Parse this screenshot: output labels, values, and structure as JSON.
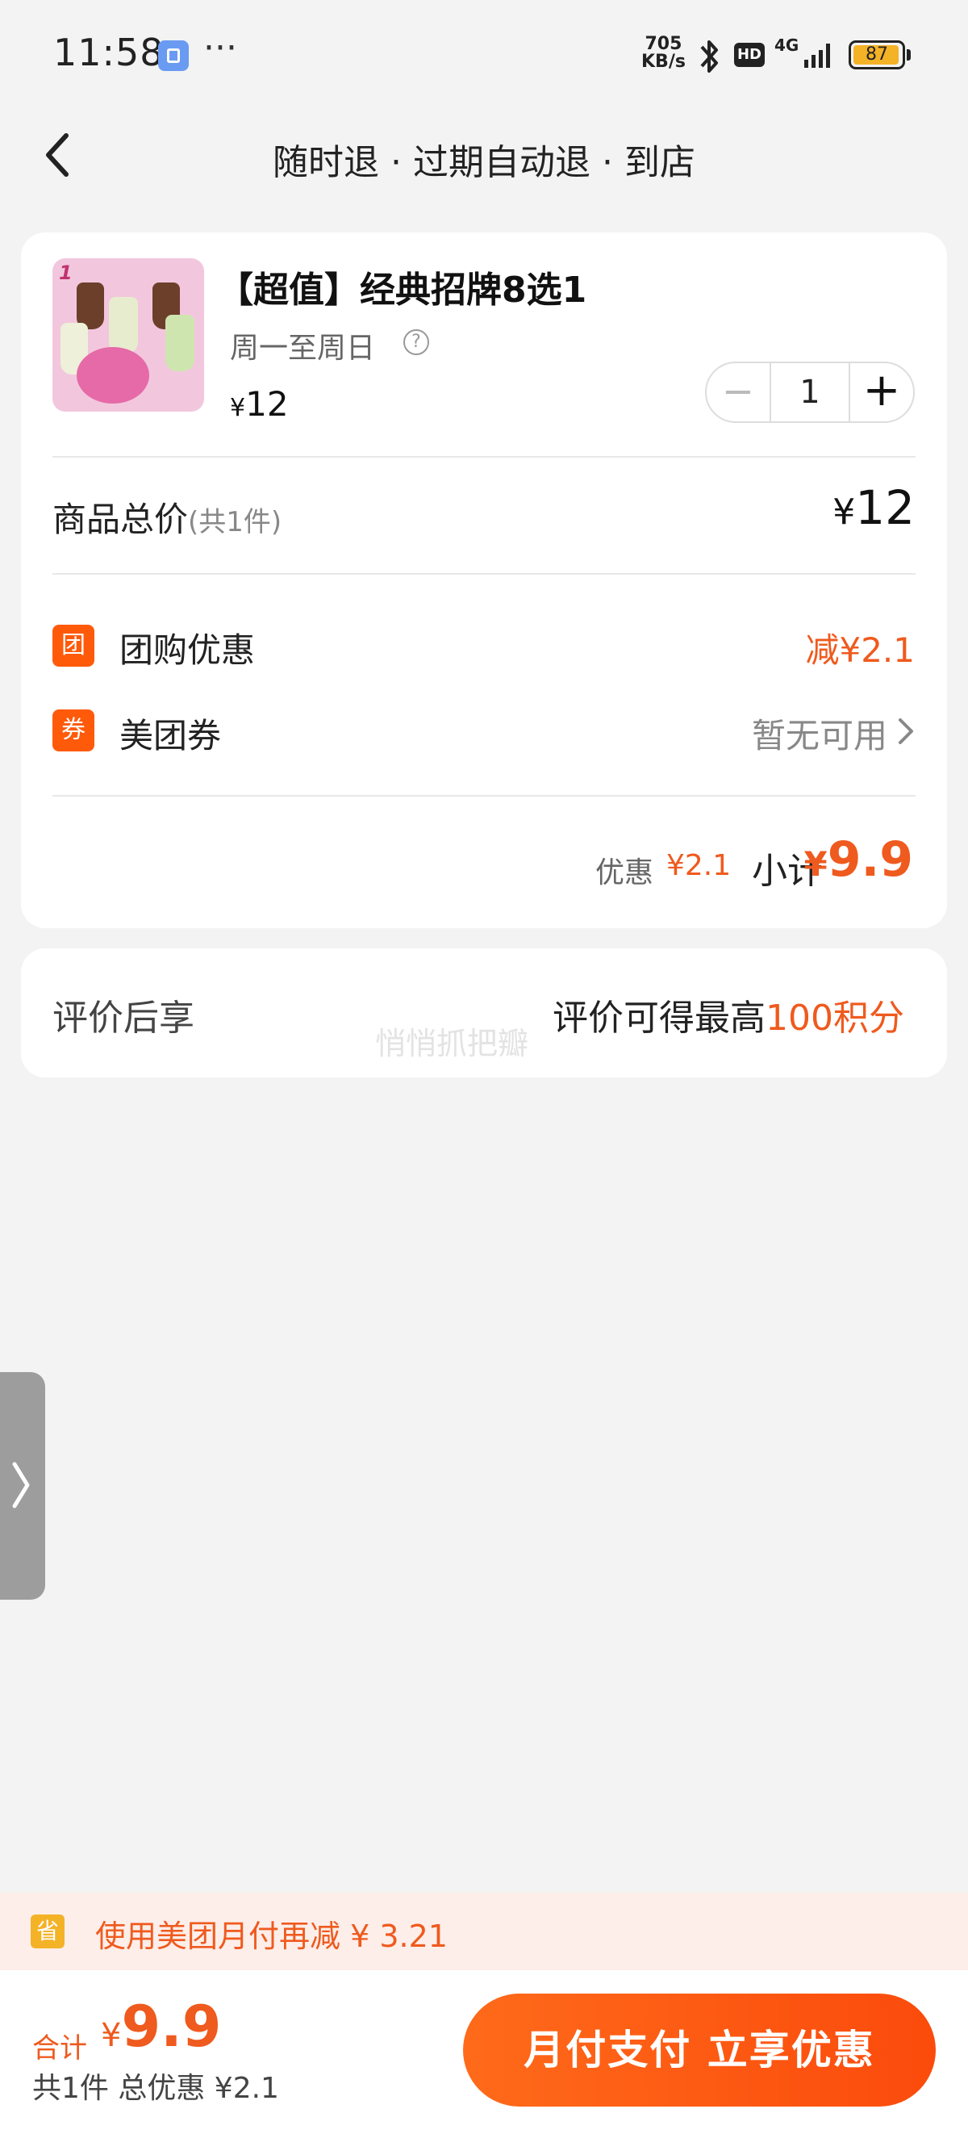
{
  "status_bar": {
    "time": "11:58",
    "dots": "···",
    "net_speed_value": "705",
    "net_speed_unit": "KB/s",
    "hd": "HD",
    "network": "4G",
    "battery": "87"
  },
  "nav": {
    "title": "随时退 · 过期自动退 · 到店"
  },
  "product": {
    "thumb_label": "1",
    "title": "【超值】经典招牌8选1",
    "schedule": "周一至周日",
    "help_icon": "?",
    "price_symbol": "¥",
    "price": "12",
    "quantity": "1",
    "minus": "−",
    "plus": "+"
  },
  "totals": {
    "label": "商品总价",
    "count": "(共1件)",
    "symbol": "¥",
    "value": "12"
  },
  "discounts": {
    "group_icon": "团",
    "group_label": "团购优惠",
    "group_value": "减¥2.1",
    "coupon_icon": "券",
    "coupon_label": "美团券",
    "coupon_value": "暂无可用"
  },
  "subtotal": {
    "discount_label": "优惠",
    "discount_value": "¥2.1",
    "label": "小计",
    "symbol": "¥",
    "value": "9.9"
  },
  "review": {
    "label": "评价后享",
    "text": "评价可得最高",
    "points": "100积分",
    "watermark": "悄悄抓把瓣"
  },
  "promo": {
    "icon": "省",
    "text": "使用美团月付再减 ¥ 3.21"
  },
  "bottom": {
    "sum_label": "合计",
    "sum_symbol": "¥",
    "sum_value": "9.9",
    "sub_text": "共1件  总优惠 ¥2.1",
    "pay_button": "月付支付 立享优惠"
  },
  "colors": {
    "accent": "#ef5a1e",
    "button_start": "#ff6a1a",
    "button_end": "#fb4b0c",
    "background": "#f3f3f3"
  },
  "icons": {
    "back": "chevron-left-icon",
    "help": "question-circle-icon",
    "coupon_arrow": "chevron-right-icon",
    "side": "chevron-right-icon",
    "bluetooth": "bluetooth-icon",
    "signal": "signal-icon",
    "battery": "battery-icon"
  }
}
